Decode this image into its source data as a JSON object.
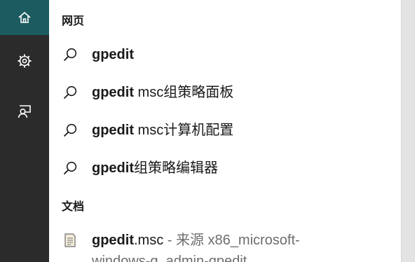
{
  "rail": {
    "icons": [
      "home-icon",
      "settings-icon",
      "feedback-icon"
    ]
  },
  "sections": {
    "web": "网页",
    "docs": "文档"
  },
  "web_results": [
    {
      "bold": "gpedit",
      "rest": ""
    },
    {
      "bold": "gpedit",
      "rest": " msc组策略面板"
    },
    {
      "bold": "gpedit",
      "rest": " msc计算机配置"
    },
    {
      "bold": "gpedit",
      "rest": "组策略编辑器"
    }
  ],
  "doc_result": {
    "bold": "gpedit",
    "name_rest": ".msc",
    "source": " - 来源 x86_microsoft-",
    "second_line": "windows-g..admin-gpedit"
  },
  "colors": {
    "rail_bg": "#2b2b2b",
    "home_active": "#1c5b5f",
    "panel_bg": "#ffffff",
    "text": "#1a1a1a",
    "muted": "#6d6d6d"
  }
}
